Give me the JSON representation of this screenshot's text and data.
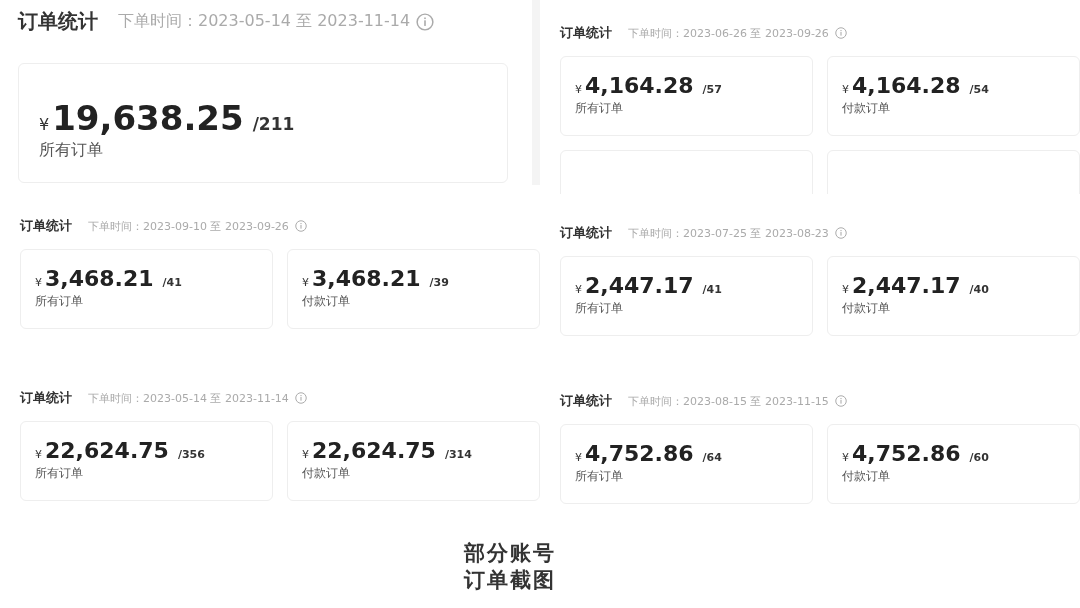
{
  "columns": [
    {
      "panels": [
        {
          "kind": "large",
          "title": "订单统计",
          "range": "下单时间：2023-05-14 至 2023-11-14",
          "cards": [
            {
              "kind": "stat",
              "currency": "¥",
              "amount": "19,638.25",
              "count": "/211",
              "label": "所有订单"
            }
          ]
        },
        {
          "kind": "compact",
          "title": "订单统计",
          "range": "下单时间：2023-09-10 至 2023-09-26",
          "cards": [
            {
              "kind": "stat",
              "currency": "¥",
              "amount": "3,468.21",
              "count": "/41",
              "label": "所有订单"
            },
            {
              "kind": "stat",
              "currency": "¥",
              "amount": "3,468.21",
              "count": "/39",
              "label": "付款订单"
            }
          ]
        },
        {
          "kind": "compact",
          "title": "订单统计",
          "range": "下单时间：2023-05-14 至 2023-11-14",
          "cards": [
            {
              "kind": "stat",
              "currency": "¥",
              "amount": "22,624.75",
              "count": "/356",
              "label": "所有订单"
            },
            {
              "kind": "stat",
              "currency": "¥",
              "amount": "22,624.75",
              "count": "/314",
              "label": "付款订单"
            }
          ]
        }
      ]
    },
    {
      "panels": [
        {
          "kind": "compact",
          "title": "订单统计",
          "range": "下单时间：2023-06-26 至 2023-09-26",
          "cards": [
            {
              "kind": "stat",
              "currency": "¥",
              "amount": "4,164.28",
              "count": "/57",
              "label": "所有订单"
            },
            {
              "kind": "stat",
              "currency": "¥",
              "amount": "4,164.28",
              "count": "/54",
              "label": "付款订单"
            },
            {
              "kind": "blank"
            },
            {
              "kind": "blank"
            }
          ]
        },
        {
          "kind": "compact",
          "title": "订单统计",
          "range": "下单时间：2023-07-25 至 2023-08-23",
          "cards": [
            {
              "kind": "stat",
              "currency": "¥",
              "amount": "2,447.17",
              "count": "/41",
              "label": "所有订单"
            },
            {
              "kind": "stat",
              "currency": "¥",
              "amount": "2,447.17",
              "count": "/40",
              "label": "付款订单"
            }
          ]
        },
        {
          "kind": "compact",
          "title": "订单统计",
          "range": "下单时间：2023-08-15 至 2023-11-15",
          "cards": [
            {
              "kind": "stat",
              "currency": "¥",
              "amount": "4,752.86",
              "count": "/64",
              "label": "所有订单"
            },
            {
              "kind": "stat",
              "currency": "¥",
              "amount": "4,752.86",
              "count": "/60",
              "label": "付款订单"
            }
          ]
        }
      ]
    }
  ],
  "caption": [
    "部分账号",
    "订单截图"
  ]
}
